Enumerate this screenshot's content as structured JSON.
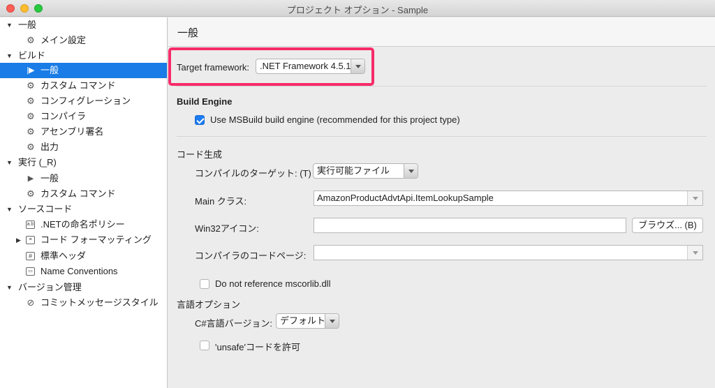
{
  "window": {
    "title": "プロジェクト オプション - Sample"
  },
  "sidebar": {
    "items": [
      {
        "label": "一般",
        "icon": "disclosure-expanded"
      },
      {
        "label": "メイン設定",
        "icon": "gear-icon"
      },
      {
        "label": "ビルド",
        "icon": "disclosure-expanded"
      },
      {
        "label": "一般",
        "icon": "play-build-icon",
        "selected": true
      },
      {
        "label": "カスタム コマンド",
        "icon": "gear-icon"
      },
      {
        "label": "コンフィグレーション",
        "icon": "gear-icon"
      },
      {
        "label": "コンパイラ",
        "icon": "gear-icon"
      },
      {
        "label": "アセンブリ署名",
        "icon": "gear-icon"
      },
      {
        "label": "出力",
        "icon": "gear-icon"
      },
      {
        "label": "実行 (_R)",
        "icon": "disclosure-expanded"
      },
      {
        "label": "一般",
        "icon": "play-icon"
      },
      {
        "label": "カスタム コマンド",
        "icon": "gear-icon"
      },
      {
        "label": "ソースコード",
        "icon": "disclosure-expanded"
      },
      {
        "label": ".NETの命名ポリシー",
        "icon": "naming-policy-icon"
      },
      {
        "label": "コード フォーマッティング",
        "icon": "code-format-icon"
      },
      {
        "label": "標準ヘッダ",
        "icon": "hash-icon"
      },
      {
        "label": "Name Conventions",
        "icon": "naming-icon"
      },
      {
        "label": "バージョン管理",
        "icon": "disclosure-expanded"
      },
      {
        "label": "コミットメッセージスタイル",
        "icon": "commit-check-icon"
      }
    ]
  },
  "main": {
    "page_title": "一般",
    "target_framework": {
      "label": "Target framework:",
      "value": ".NET Framework 4.5.1"
    },
    "build_engine": {
      "heading": "Build Engine",
      "use_msbuild_label": "Use MSBuild build engine (recommended for this project type)",
      "use_msbuild_checked": true
    },
    "codegen": {
      "heading": "コード生成",
      "compile_target_label": "コンパイルのターゲット: (T)",
      "compile_target_value": "実行可能ファイル",
      "main_class_label": "Main クラス:",
      "main_class_value": "AmazonProductAdvtApi.ItemLookupSample",
      "win32_icon_label": "Win32アイコン:",
      "win32_icon_value": "",
      "browse_button": "ブラウズ... (B)",
      "codepage_label": "コンパイラのコードページ:",
      "codepage_value": "",
      "no_mscorlib_label": "Do not reference mscorlib.dll",
      "no_mscorlib_checked": false
    },
    "language": {
      "heading": "言語オプション",
      "csharp_version_label": "C#言語バージョン:",
      "csharp_version_value": "デフォルト",
      "allow_unsafe_label": "'unsafe'コードを許可",
      "allow_unsafe_checked": false
    }
  },
  "colors": {
    "selection": "#1a7ce6",
    "highlight_border": "#f72c6a",
    "checkbox_blue": "#1b7cf1"
  }
}
